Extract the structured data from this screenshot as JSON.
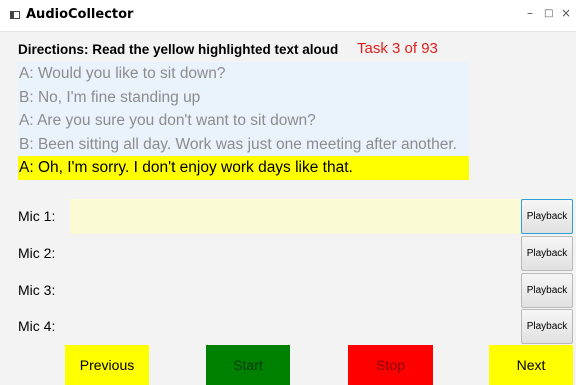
{
  "window": {
    "title": "AudioCollector",
    "controls": {
      "minimize": "–",
      "maximize": "□",
      "close": "×"
    }
  },
  "directions": "Directions: Read the yellow highlighted text aloud",
  "task": "Task 3 of 93",
  "dialogue": [
    "A: Would you like to sit down?",
    "B: No, I'm fine standing up",
    "A: Are you sure you don't want to sit down?",
    "B: Been sitting all day. Work was just one meeting after another.",
    "A: Oh, I'm sorry. I don't enjoy work days like that."
  ],
  "mics": [
    {
      "label": "Mic 1:",
      "playback": "Playback"
    },
    {
      "label": "Mic 2:",
      "playback": "Playback"
    },
    {
      "label": "Mic 3:",
      "playback": "Playback"
    },
    {
      "label": "Mic 4:",
      "playback": "Playback"
    }
  ],
  "buttons": {
    "previous": "Previous",
    "start": "Start",
    "stop": "Stop",
    "next": "Next"
  },
  "colors": {
    "highlight": "#ffff00",
    "task_text": "#e0201c",
    "start_button": "#008000",
    "stop_button": "#ff0000",
    "nav_button": "#ffff00",
    "mic1_field": "#fafad4",
    "dialogue_background": "#eaf3fb"
  },
  "icons": {
    "app": "window-app-icon"
  }
}
